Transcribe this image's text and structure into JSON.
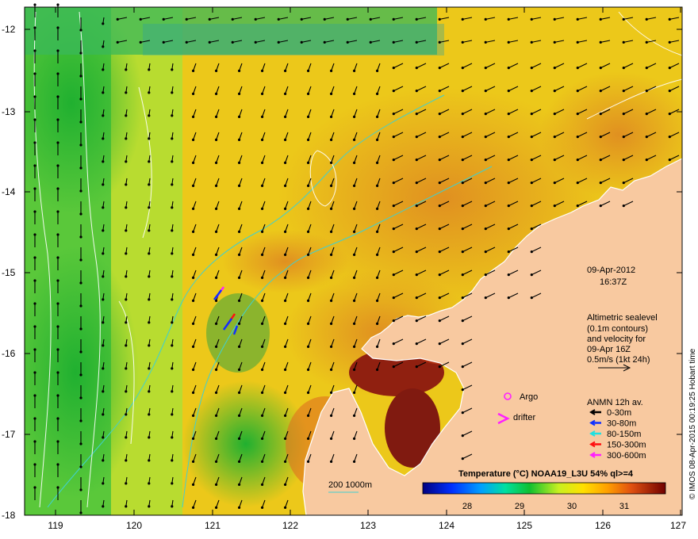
{
  "map": {
    "x_ticks": [
      "119",
      "120",
      "121",
      "122",
      "123",
      "124",
      "125",
      "126",
      "127"
    ],
    "y_ticks": [
      "-12",
      "-13",
      "-14",
      "-15",
      "-16",
      "-17",
      "-18"
    ],
    "date": "09-Apr-2012",
    "time": "16:37Z",
    "altimetry_lines": [
      "Altimetric sealevel",
      "(0.1m contours)",
      "and velocity for",
      "09-Apr 16Z",
      "0.5m/s (1kt 24h)"
    ],
    "argo_label": "Argo",
    "drifter_label": "drifter",
    "anmn_title": "ANMN 12h av.",
    "depth_legend": [
      {
        "label": "0-30m",
        "color": "#000000"
      },
      {
        "label": "30-80m",
        "color": "#1030ff"
      },
      {
        "label": "80-150m",
        "color": "#20e0e0"
      },
      {
        "label": "150-300m",
        "color": "#ff1010"
      },
      {
        "label": "300-600m",
        "color": "#ff20ff"
      }
    ],
    "isobath_label": "200  1000m",
    "colorbar_title": "Temperature (°C) NOAA19_L3U 54% ql>=4",
    "colorbar_ticks": [
      "28",
      "29",
      "30",
      "31"
    ],
    "credit": "© IMOS 08-Apr-2015 00:19:25 Hobart time",
    "colors": {
      "land": "#f8c9a0",
      "isobath": "#40d0d0",
      "argo": "#ff20ff",
      "drifter": "#ff20ff"
    }
  }
}
